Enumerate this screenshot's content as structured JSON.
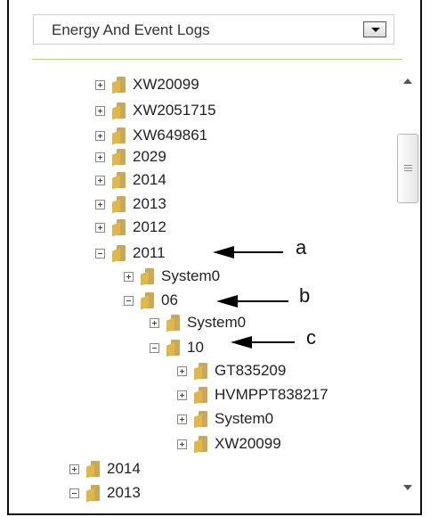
{
  "dropdown": {
    "selected": "Energy And Event Logs"
  },
  "tree": {
    "rows": [
      {
        "label": "XW20099",
        "expanded": false
      },
      {
        "label": "XW2051715",
        "expanded": false
      },
      {
        "label": "XW649861",
        "expanded": false
      },
      {
        "label": "2029",
        "expanded": false
      },
      {
        "label": "2014",
        "expanded": false
      },
      {
        "label": "2013",
        "expanded": false
      },
      {
        "label": "2012",
        "expanded": false
      },
      {
        "label": "2011",
        "expanded": true
      },
      {
        "label": "System0",
        "expanded": false
      },
      {
        "label": "06",
        "expanded": true
      },
      {
        "label": "System0",
        "expanded": false
      },
      {
        "label": "10",
        "expanded": true
      },
      {
        "label": "GT835209",
        "expanded": false
      },
      {
        "label": "HVMPPT838217",
        "expanded": false
      },
      {
        "label": "System0",
        "expanded": false
      },
      {
        "label": "XW20099",
        "expanded": false
      },
      {
        "label": "2014",
        "expanded": false
      },
      {
        "label": "2013",
        "expanded": true
      }
    ]
  },
  "annotations": {
    "a": "a",
    "b": "b",
    "c": "c"
  },
  "colors": {
    "divider": "#a8d08d",
    "folder": "#e0b84a"
  },
  "icons": {
    "expander_plus": "plus-box-icon",
    "expander_minus": "minus-box-icon",
    "folder": "folder-icon"
  }
}
